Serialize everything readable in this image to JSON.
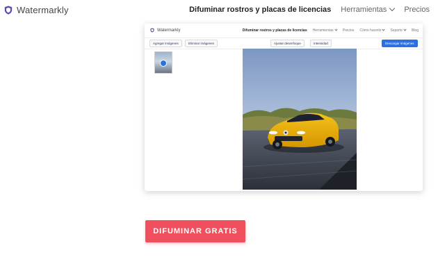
{
  "header": {
    "brand_name": "Watermarkly",
    "nav": {
      "item1": "Difuminar rostros y placas de licencias",
      "item2": "Herramientas",
      "item3": "Precios"
    }
  },
  "preview": {
    "brand_name": "Watermarkly",
    "nav": {
      "item1": "Difuminar rostros y placas de licencias",
      "item2": "Herramientas",
      "item3": "Precios",
      "item4": "Cómo hacerlo",
      "item5": "Soporte",
      "item6": "Blog"
    },
    "toolbar": {
      "add_images": "Agregar imágenes",
      "remove_images": "Eliminar imágenes",
      "adjust_blur": "Ajustar desenfoque",
      "intensity": "Intensidad",
      "download": "Descargar imágenes"
    }
  },
  "cta": {
    "label": "DIFUMINAR GRATIS"
  },
  "colors": {
    "accent": "#f0505e",
    "brand_shield": "#5b4bb7",
    "primary_button": "#2b6fe0"
  },
  "icons": [
    "shield-logo-icon",
    "chevron-down-icon",
    "checkmark-icon"
  ]
}
